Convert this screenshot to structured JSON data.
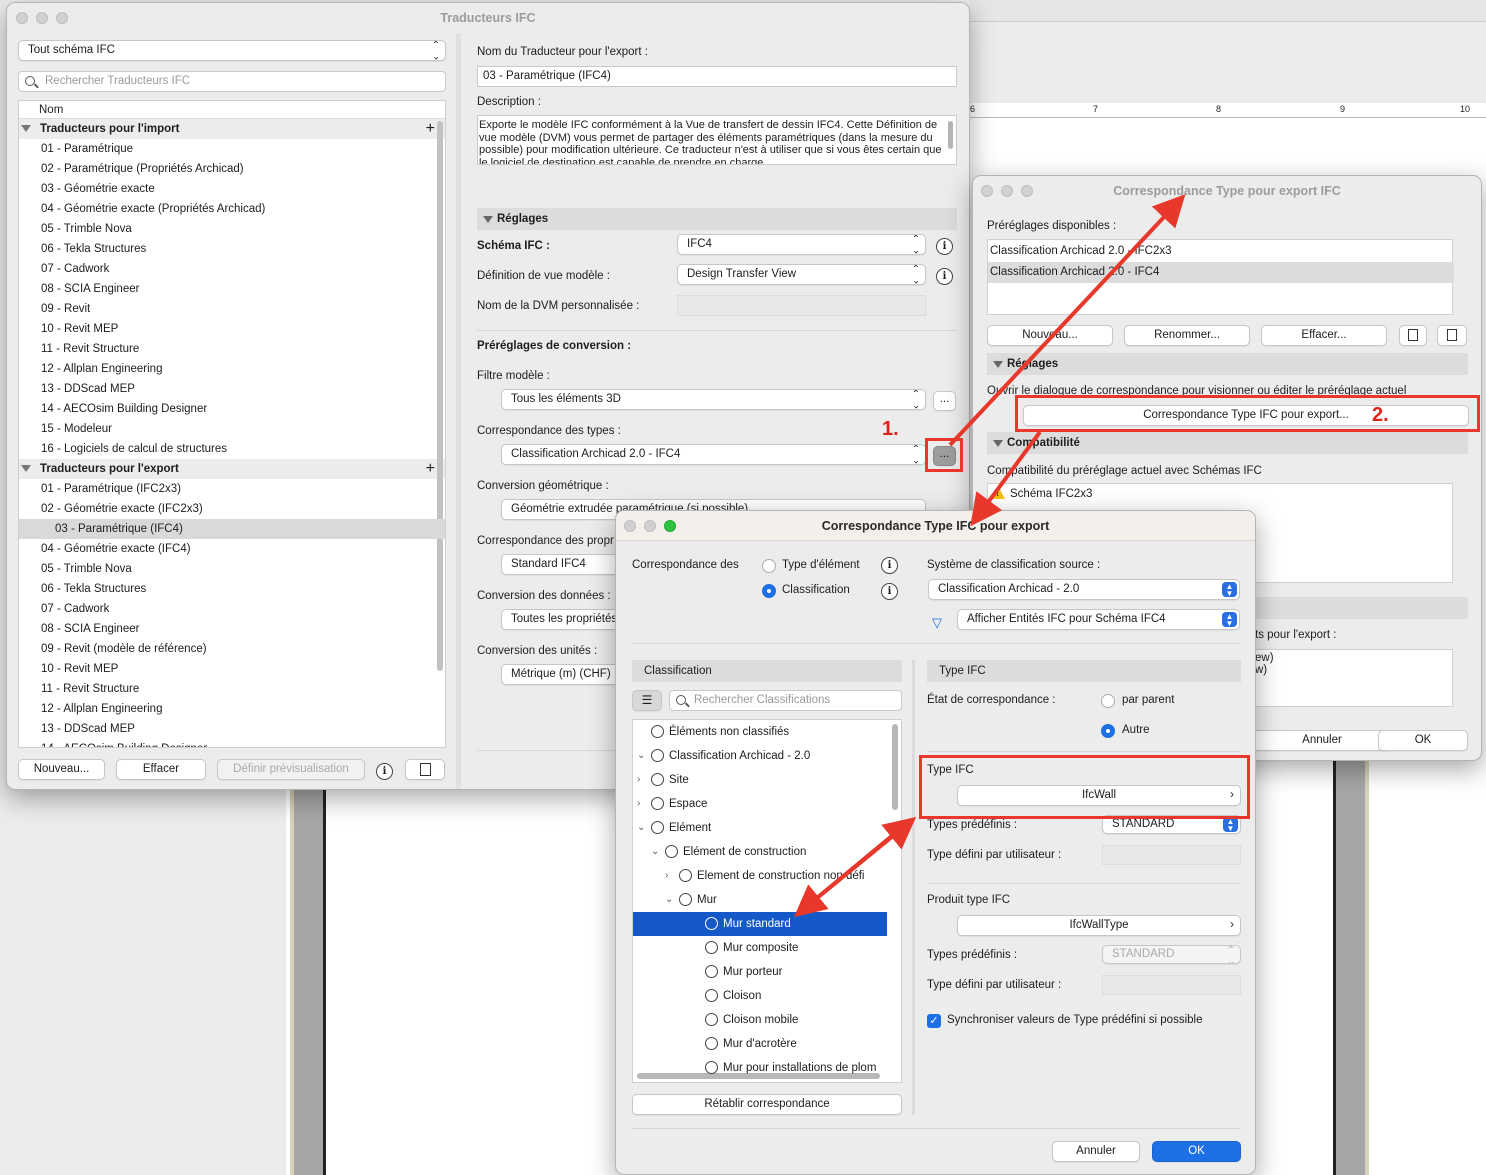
{
  "bg": {
    "ruler_numbers": [
      "6",
      "7",
      "8",
      "9",
      "10"
    ]
  },
  "main_window": {
    "title": "Traducteurs IFC",
    "schema_filter": "Tout schéma IFC",
    "search_placeholder": "Rechercher Traducteurs IFC",
    "column_name": "Nom",
    "import_group": "Traducteurs pour l'import",
    "import_items": [
      "01 - Paramétrique",
      "02 - Paramétrique (Propriétés Archicad)",
      "03 - Géométrie exacte",
      "04 - Géométrie exacte (Propriétés Archicad)",
      "05 - Trimble Nova",
      "06 - Tekla Structures",
      "07 - Cadwork",
      "08 - SCIA Engineer",
      "09 - Revit",
      "10 - Revit MEP",
      "11 - Revit Structure",
      "12 - Allplan Engineering",
      "13 - DDScad MEP",
      "14 - AECOsim Building Designer",
      "15 - Modeleur",
      "16 - Logiciels de calcul de structures"
    ],
    "export_group": "Traducteurs pour l'export",
    "export_items": [
      "01 - Paramétrique (IFC2x3)",
      "02 - Géométrie exacte (IFC2x3)",
      "03 - Paramétrique (IFC4)",
      "04 - Géométrie exacte (IFC4)",
      "05 - Trimble Nova",
      "06 - Tekla Structures",
      "07 - Cadwork",
      "08 - SCIA Engineer",
      "09 - Revit (modèle de référence)",
      "10 - Revit MEP",
      "11 - Revit Structure",
      "12 - Allplan Engineering",
      "13 - DDScad MEP",
      "14 - AECOsim Building Designer"
    ],
    "btn_new": "Nouveau...",
    "btn_delete": "Effacer",
    "btn_preview": "Définir prévisualisation",
    "name_label": "Nom du Traducteur pour l'export :",
    "name_value": "03 - Paramétrique (IFC4)",
    "description_label": "Description :",
    "description_text": "Exporte le modèle IFC conformément à la Vue de transfert de dessin IFC4. Cette Définition de vue modèle (DVM) vous permet de partager des éléments paramétriques (dans la mesure du possible) pour modification ultérieure. Ce traducteur n'est à utiliser que si vous êtes certain que le logiciel de destination est capable de prendre en charge",
    "settings_header": "Réglages",
    "schema_label": "Schéma IFC :",
    "schema_value": "IFC4",
    "mvd_label": "Définition de vue modèle :",
    "mvd_value": "Design Transfer View",
    "mvd_custom_label": "Nom de la DVM personnalisée :",
    "presets_label": "Préréglages de conversion :",
    "model_filter_label": "Filtre modèle :",
    "model_filter_value": "Tous les éléments 3D",
    "type_mapping_label": "Correspondance des types :",
    "type_mapping_value": "Classification Archicad 2.0 - IFC4",
    "geometry_label": "Conversion géométrique :",
    "geometry_value": "Géométrie extrudée paramétrique (si possible)",
    "property_label": "Correspondance des propr",
    "property_value": "Standard IFC4",
    "data_label": "Conversion des données :",
    "data_value": "Toutes les propriétés",
    "units_label": "Conversion des unités :",
    "units_value": "Métrique (m) (CHF)",
    "more": "..."
  },
  "export_type_window": {
    "title": "Correspondance Type pour export IFC",
    "available_label": "Préréglages disponibles :",
    "presets": [
      "Classification Archicad 2.0 - IFC2x3",
      "Classification Archicad 2.0 - IFC4"
    ],
    "btn_new": "Nouveau...",
    "btn_rename": "Renommer...",
    "btn_delete": "Effacer...",
    "settings_header": "Réglages",
    "settings_text": "Ouvrir le dialogue de correspondance pour visionner ou éditer le préréglage actuel",
    "open_btn": "Correspondance Type IFC pour export...",
    "compat_header": "Compatibilité",
    "compat_text": "Compatibilité du préréglage actuel avec Schémas IFC",
    "compat_item": "Schéma IFC2x3",
    "partial_text": "ts pour l'export :",
    "partial_list": [
      "ew)",
      "w)"
    ],
    "btn_cancel": "Annuler",
    "btn_ok": "OK"
  },
  "mapping_dialog": {
    "title": "Correspondance Type IFC pour export",
    "mapping_of_label": "Correspondance des",
    "opt_element": "Type d'élément",
    "opt_classification": "Classification",
    "source_label": "Système de classification source :",
    "source_value": "Classification Archicad - 2.0",
    "filter_value": "Afficher Entités IFC pour Schéma IFC4",
    "left_header": "Classification",
    "search_placeholder": "Rechercher Classifications",
    "tree": [
      "Éléments non classifiés",
      "Classification Archicad - 2.0",
      "Site",
      "Espace",
      "Elément",
      "Elément de construction",
      "Element de construction non défi",
      "Mur",
      "Mur standard",
      "Mur composite",
      "Mur porteur",
      "Cloison",
      "Cloison mobile",
      "Mur d'acrotère",
      "Mur pour installations de plom"
    ],
    "reset_btn": "Rétablir correspondance",
    "right_header": "Type IFC",
    "state_label": "État de correspondance :",
    "opt_parent": "par parent",
    "opt_other": "Autre",
    "ifc_type_label": "Type IFC",
    "ifc_type_value": "IfcWall",
    "predef_label": "Types prédéfinis :",
    "predef_value": "STANDARD",
    "user_type_label": "Type défini par utilisateur :",
    "product_label": "Produit type IFC",
    "product_value": "IfcWallType",
    "predef2_value": "STANDARD",
    "sync_label": "Synchroniser valeurs de Type prédéfini si possible",
    "btn_cancel": "Annuler",
    "btn_ok": "OK"
  },
  "annotations": {
    "step1": "1.",
    "step2": "2."
  }
}
